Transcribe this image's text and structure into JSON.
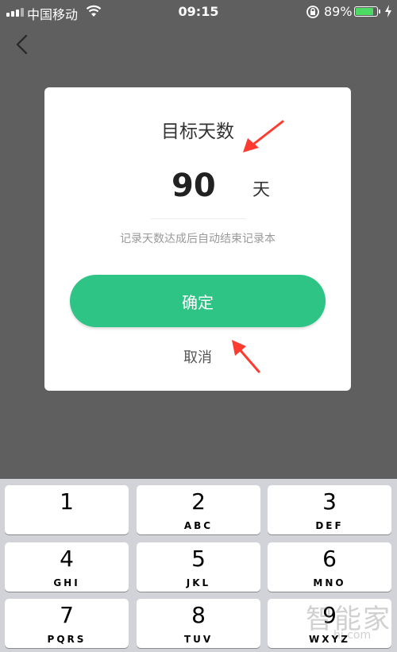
{
  "status_bar": {
    "carrier": "中国移动",
    "time": "09:15",
    "battery_percent": "89%",
    "battery_level": 0.89
  },
  "nav": {
    "back_icon": "chevron-left-icon"
  },
  "dialog": {
    "title": "目标天数",
    "days_value": "90",
    "days_unit": "天",
    "hint": "记录天数达成后自动结束记录本",
    "confirm_label": "确定",
    "cancel_label": "取消"
  },
  "keypad": {
    "keys": [
      {
        "digit": "1",
        "letters": ""
      },
      {
        "digit": "2",
        "letters": "ABC"
      },
      {
        "digit": "3",
        "letters": "DEF"
      },
      {
        "digit": "4",
        "letters": "GHI"
      },
      {
        "digit": "5",
        "letters": "JKL"
      },
      {
        "digit": "6",
        "letters": "MNO"
      },
      {
        "digit": "7",
        "letters": "PQRS"
      },
      {
        "digit": "8",
        "letters": "TUV"
      },
      {
        "digit": "9",
        "letters": "WXYZ"
      }
    ]
  },
  "watermark": {
    "text": "智能家",
    "sub": "hj.com"
  },
  "colors": {
    "overlay": "#5f5f5f",
    "accent": "#2ec485",
    "annotation_arrow": "#ff3b30"
  }
}
